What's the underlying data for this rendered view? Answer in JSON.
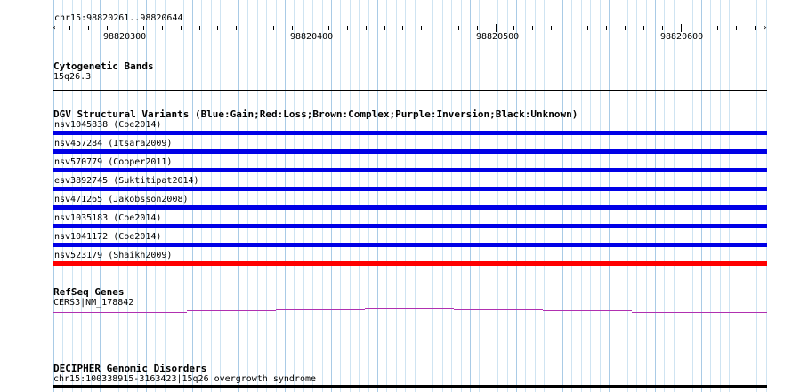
{
  "header": {
    "location": "chr15:98820261..98820644",
    "ruler_ticks": [
      "98820300",
      "98820400",
      "98820500",
      "98820600"
    ]
  },
  "tracks": {
    "cytobands": {
      "title": "Cytogenetic Bands",
      "label": "15q26.3"
    },
    "dgv": {
      "title": "DGV Structural Variants (Blue:Gain;Red:Loss;Brown:Complex;Purple:Inversion;Black:Unknown)",
      "colors": {
        "gain": "#0000e6",
        "loss": "#ff0000"
      },
      "features": [
        {
          "label": "nsv1045838 (Coe2014)",
          "type": "gain"
        },
        {
          "label": "nsv457284 (Itsara2009)",
          "type": "gain"
        },
        {
          "label": "nsv570779 (Cooper2011)",
          "type": "gain"
        },
        {
          "label": "esv3892745 (Suktitipat2014)",
          "type": "gain"
        },
        {
          "label": "nsv471265 (Jakobsson2008)",
          "type": "gain"
        },
        {
          "label": "nsv1035183 (Coe2014)",
          "type": "gain"
        },
        {
          "label": "nsv1041172 (Coe2014)",
          "type": "gain"
        },
        {
          "label": "nsv523179 (Shaikh2009)",
          "type": "loss"
        }
      ]
    },
    "refseq": {
      "title": "RefSeq Genes",
      "label": "CERS3|NM_178842",
      "color": "#b030b0"
    },
    "decipher": {
      "title": "DECIPHER Genomic Disorders",
      "label": "chr15:100338915-3163423|15q26 overgrowth syndrome"
    }
  }
}
